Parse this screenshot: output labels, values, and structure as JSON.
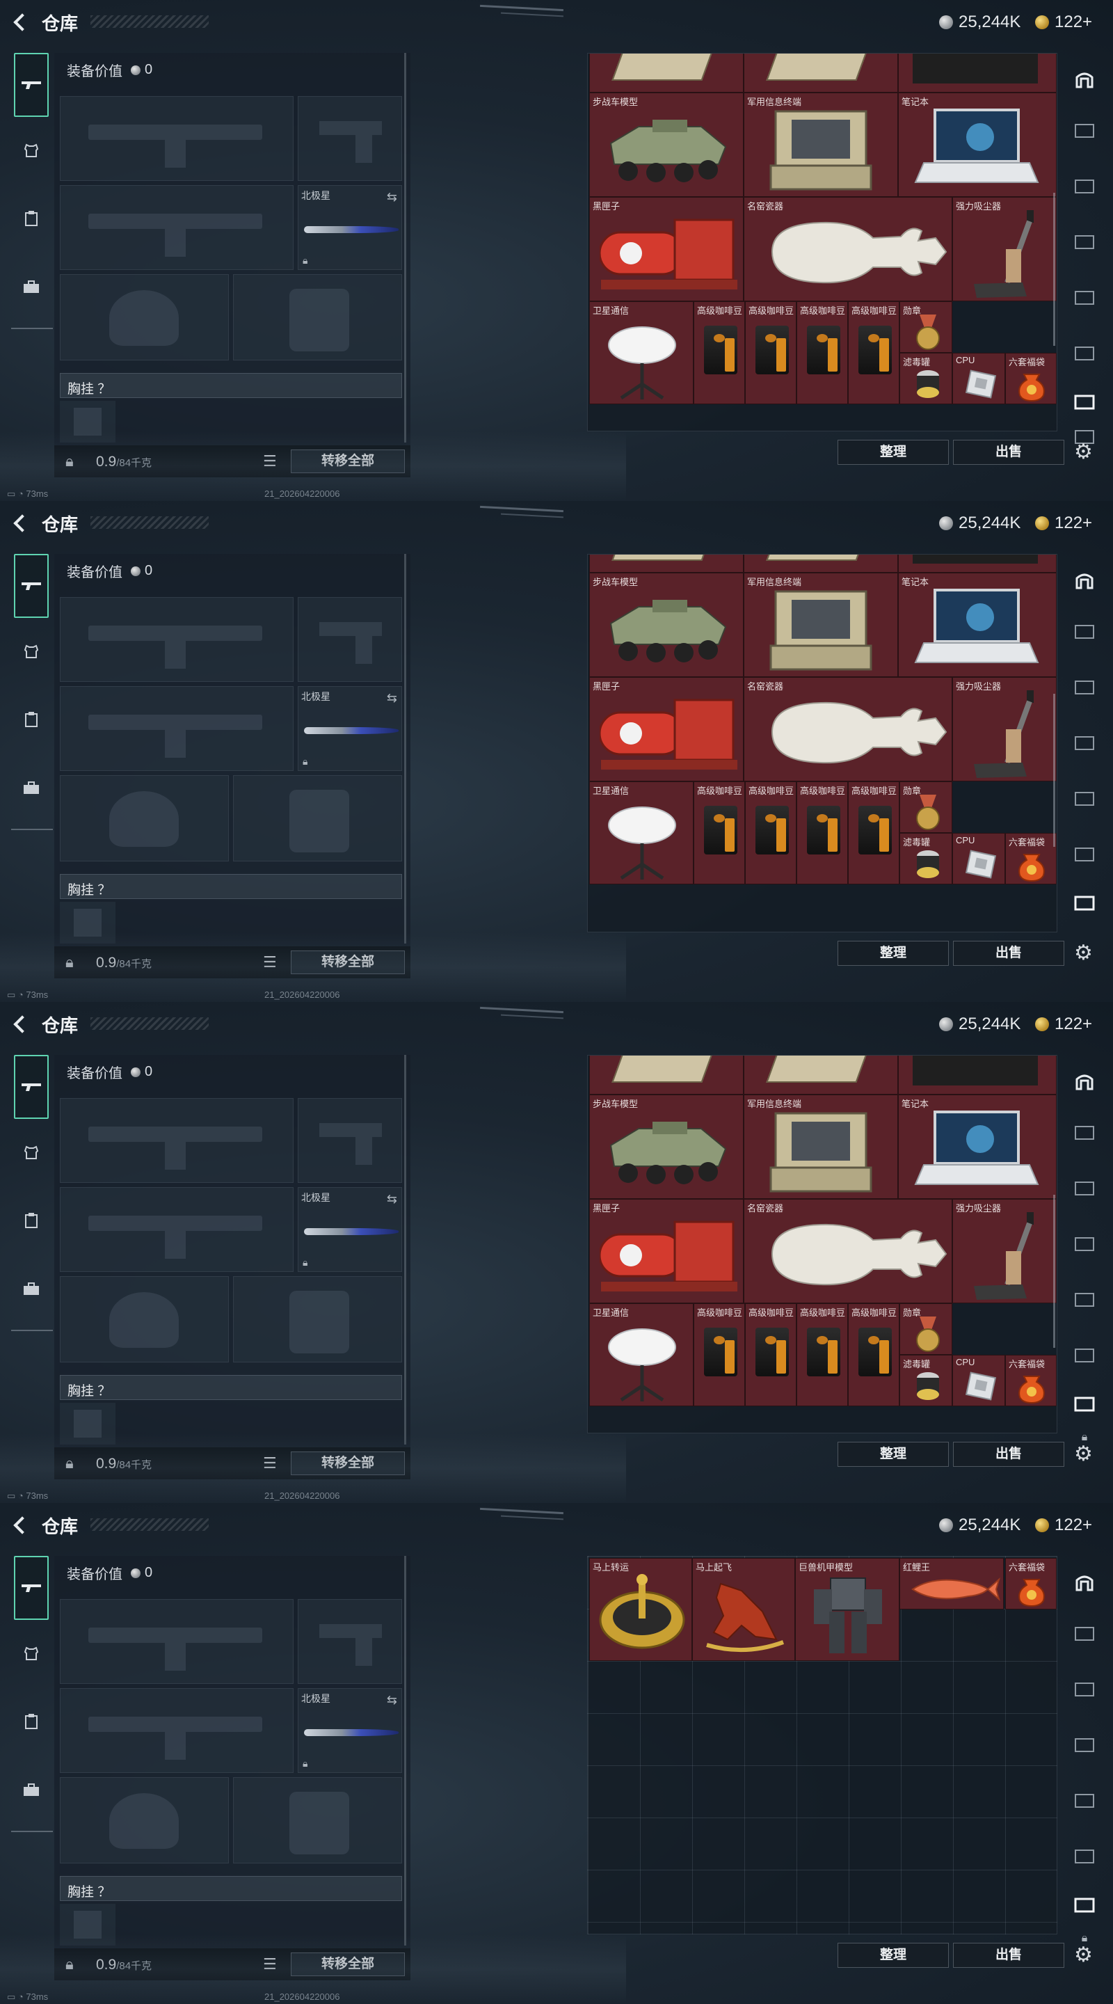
{
  "colors": {
    "accent": "#5fd4b1",
    "item_cell": "#5a2229",
    "background": "#1b2631"
  },
  "header": {
    "title": "仓库",
    "money": "25,244K",
    "gold": "122+"
  },
  "loadout": {
    "value_label": "装备价值",
    "value": "0",
    "melee_label": "北极星",
    "chest_label": "胸挂 ？",
    "weight_value": "0.9",
    "weight_cap": "/84千克",
    "transfer_all": "转移全部"
  },
  "rail_icons": [
    "gun-icon",
    "vest-icon",
    "clipboard-icon",
    "briefcase-icon"
  ],
  "right_tabs": [
    "vault-icon",
    "tv-tab-1",
    "tv-tab-2",
    "tv-tab-3",
    "tv-tab-4",
    "tv-tab-5",
    "tv-tab-active",
    "tv-tab-6"
  ],
  "buttons": {
    "sort": "整理",
    "sell": "出售"
  },
  "status": {
    "ping": "73ms",
    "build": "21_202604220006"
  },
  "items": {
    "ifv": "步战车模型",
    "terminal": "军用信息终端",
    "laptop": "笔记本",
    "blackbox": "黑匣子",
    "vase": "名窑瓷器",
    "vacuum": "强力吸尘器",
    "satellite": "卫星通信",
    "coffee": "高级咖啡豆",
    "medal": "勋章",
    "filter": "滤毒罐",
    "cpu": "CPU",
    "pouch": "六套福袋",
    "wheel": "马上转运",
    "horse": "马上起飞",
    "mech": "巨兽机甲模型",
    "koi": "红鲤王"
  }
}
